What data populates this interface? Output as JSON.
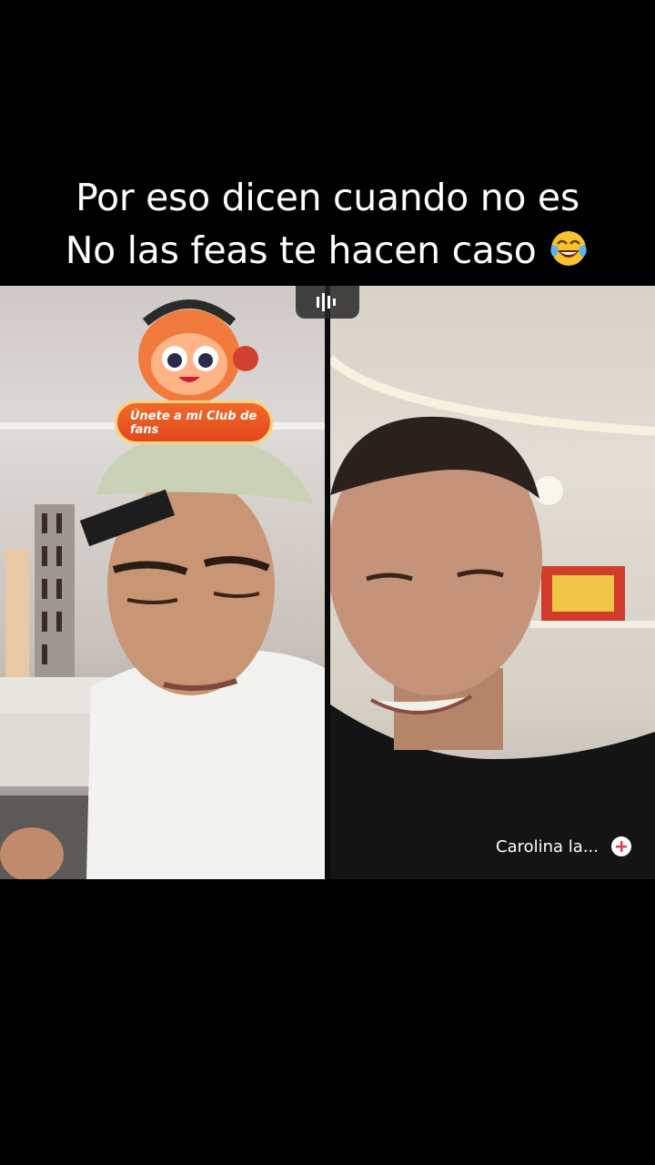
{
  "caption": {
    "line1": "Por eso dicen cuando no es",
    "line2": "No las feas te hacen caso"
  },
  "icons": {
    "caption_emoji": "face-with-tears-of-joy-icon",
    "audio": "audio-waveform-icon",
    "add": "plus-circle-icon"
  },
  "live": {
    "left_badge_text": "Únete a mi Club de fans",
    "right_name": "Carolina la..."
  },
  "colors": {
    "badge_orange": "#e2481b",
    "badge_border": "#ffd27a",
    "plus_red": "#e8334a"
  }
}
